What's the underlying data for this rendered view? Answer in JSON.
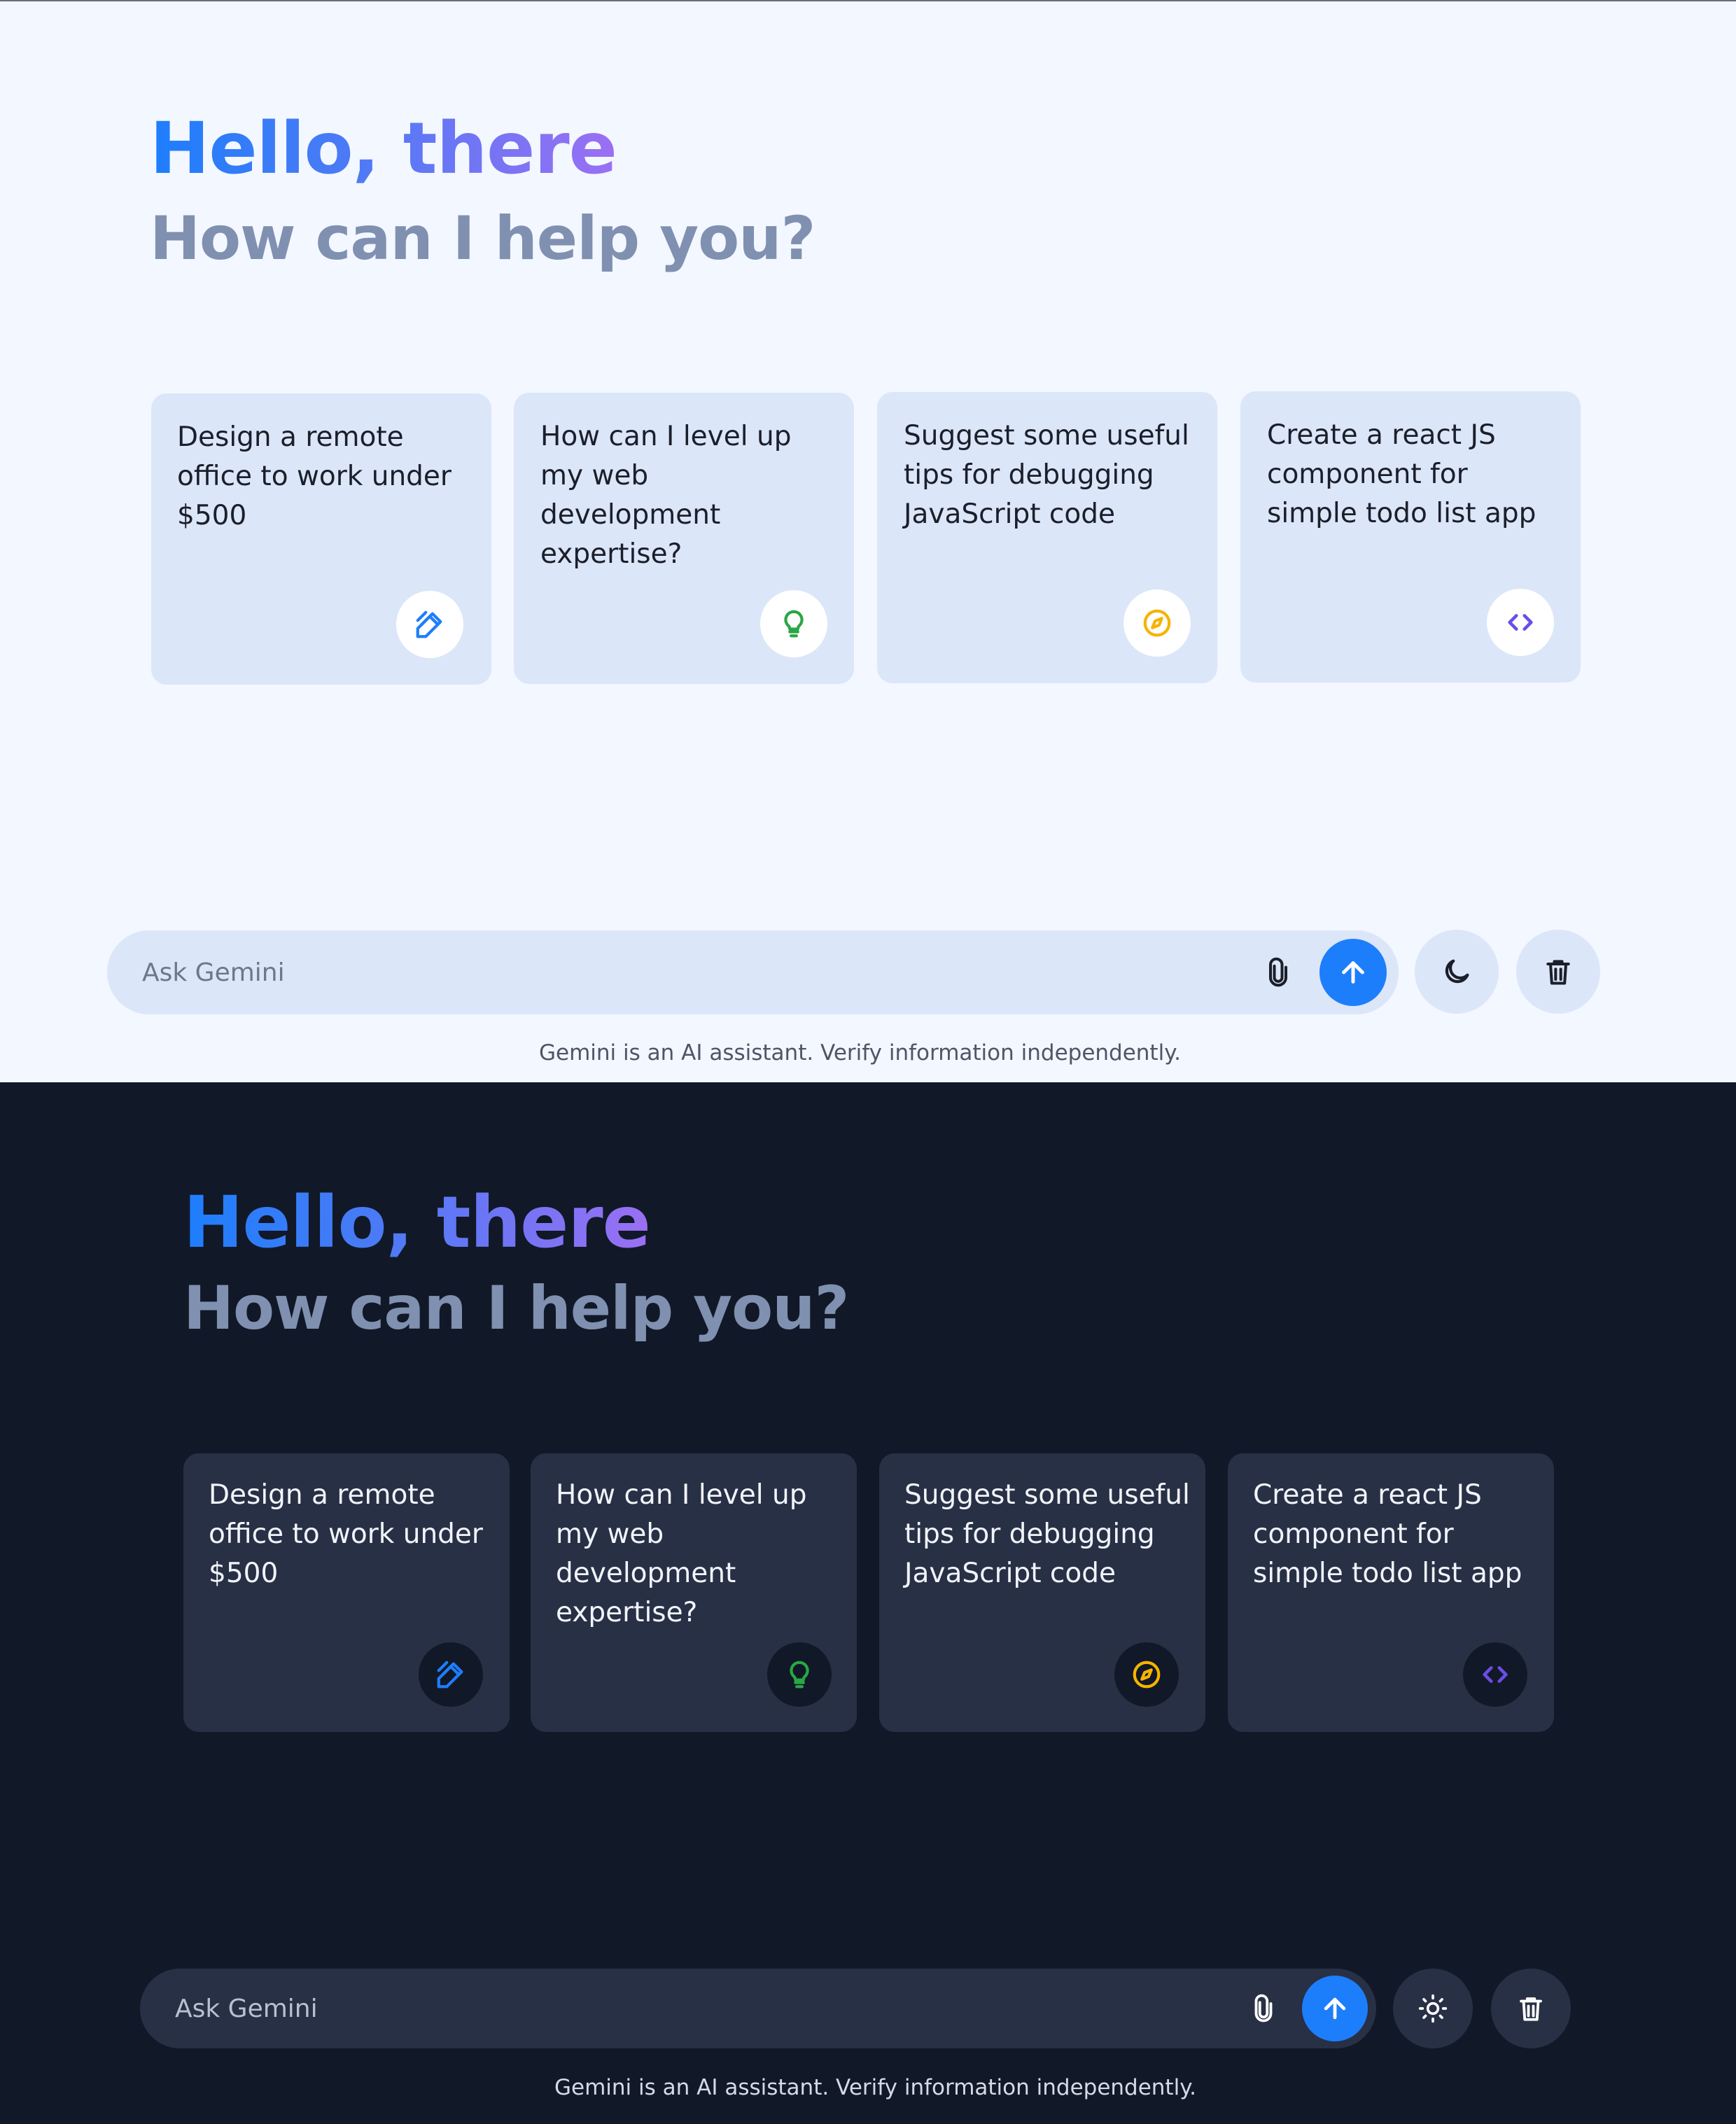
{
  "light": {
    "greeting": "Hello, there",
    "subtitle": "How can I help you?",
    "cards": [
      {
        "text": "Design a remote office to work under $500",
        "icon": "draw-icon",
        "icon_color": "#1d7efc"
      },
      {
        "text": "How can I level up my web development expertise?",
        "icon": "lightbulb-icon",
        "icon_color": "#28a745"
      },
      {
        "text": "Suggest some useful tips for debugging JavaScript code",
        "icon": "compass-icon",
        "icon_color": "#f5b400"
      },
      {
        "text": "Create a react JS component for simple todo list app",
        "icon": "code-icon",
        "icon_color": "#6b4de6"
      }
    ],
    "prompt_placeholder": "Ask Gemini",
    "theme_toggle_icon": "moon-icon",
    "disclaimer": "Gemini is an AI assistant. Verify information independently."
  },
  "dark": {
    "greeting": "Hello, there",
    "subtitle": "How can I help you?",
    "cards": [
      {
        "text": "Design a remote office to work under $500",
        "icon": "draw-icon",
        "icon_color": "#1d7efc"
      },
      {
        "text": "How can I level up my web development expertise?",
        "icon": "lightbulb-icon",
        "icon_color": "#28a745"
      },
      {
        "text": "Suggest some useful tips for debugging JavaScript code",
        "icon": "compass-icon",
        "icon_color": "#f5b400"
      },
      {
        "text": "Create a react JS component for simple todo list app",
        "icon": "code-icon",
        "icon_color": "#6b4de6"
      }
    ],
    "prompt_placeholder": "Ask Gemini",
    "theme_toggle_icon": "sun-icon",
    "disclaimer": "Gemini is an AI assistant. Verify information independently."
  },
  "colors": {
    "accent": "#1d7efc",
    "light_bg": "#f3f7ff",
    "dark_bg": "#111827",
    "light_card": "#dce6f9",
    "dark_card": "#283045"
  }
}
